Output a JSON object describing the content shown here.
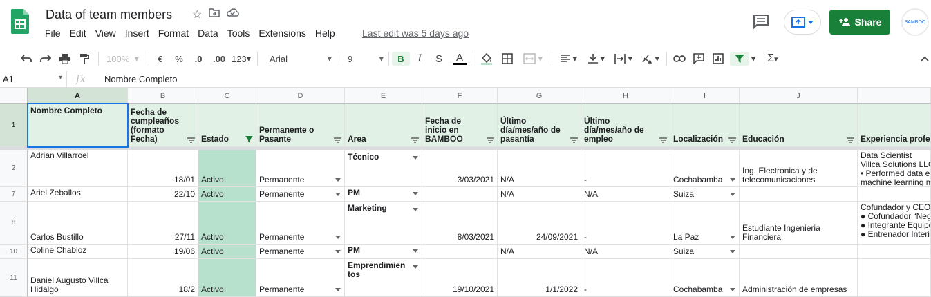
{
  "app": {
    "doc_title": "Data of team members",
    "menu": [
      "File",
      "Edit",
      "View",
      "Insert",
      "Format",
      "Data",
      "Tools",
      "Extensions",
      "Help"
    ],
    "last_edit": "Last edit was 5 days ago",
    "share_label": "Share",
    "avatar_text": "BAMBOO",
    "brand_color": "#188038"
  },
  "toolbar": {
    "zoom": "100%",
    "currency": "€",
    "percent": "%",
    "dec_less": ".0",
    "dec_more": ".00",
    "more_formats": "123",
    "font": "Arial",
    "font_size": "9",
    "bold": "B",
    "italic": "I",
    "strike": "S",
    "text_color": "A",
    "sigma": "Σ"
  },
  "formula_bar": {
    "cell_ref": "A1",
    "fx": "fx",
    "value": "Nombre Completo"
  },
  "columns": [
    "A",
    "B",
    "C",
    "D",
    "E",
    "F",
    "G",
    "H",
    "I",
    "J"
  ],
  "headers": {
    "a": "Nombre Completo",
    "b": "Fecha de cumpleaños (formato Fecha)",
    "c": "Estado",
    "d": "Permanente o Pasante",
    "e": "Area",
    "f": "Fecha de inicio en BAMBOO",
    "g": "Último día/mes/año de pasantía",
    "h": "Último día/mes/año de empleo",
    "i": "Localización",
    "j": "Educación",
    "k": "Experiencia profe"
  },
  "row_numbers": [
    "1",
    "2",
    "7",
    "8",
    "10",
    "11"
  ],
  "rows": [
    {
      "a": "Adrian Villarroel",
      "b": "18/01",
      "c": "Activo",
      "d": "Permanente",
      "e": "Técnico",
      "f": "3/03/2021",
      "g": "N/A",
      "h": "-",
      "i": "Cochabamba",
      "j": "Ing. Electronica y de telecomunicaciones",
      "k": "Data Scientist\nVillca Solutions LLC\n• Performed data e\nmachine learning m"
    },
    {
      "a": "Ariel Zeballos",
      "b": "22/10",
      "c": "Activo",
      "d": "Permanente",
      "e": "PM",
      "f": "",
      "g": "N/A",
      "h": "N/A",
      "i": "Suiza",
      "j": "",
      "k": ""
    },
    {
      "a": "Carlos Bustillo",
      "b": "27/11",
      "c": "Activo",
      "d": "Permanente",
      "e": "Marketing",
      "f": "8/03/2021",
      "g": "24/09/2021",
      "h": "-",
      "i": "La Paz",
      "j": "Estudiante Ingenieria Financiera",
      "k": "Cofundador y CEO\n● Cofundador “Neg\n● Integrante Equipo\n● Entrenador Interin"
    },
    {
      "a": "Coline Chabloz",
      "b": "19/06",
      "c": "Activo",
      "d": "Permanente",
      "e": "PM",
      "f": "",
      "g": "N/A",
      "h": "N/A",
      "i": "Suiza",
      "j": "",
      "k": ""
    },
    {
      "a": "Daniel Augusto Villca Hidalgo",
      "b": "18/2",
      "c": "Activo",
      "d": "Permanente",
      "e": "Emprendimientos",
      "f": "19/10/2021",
      "g": "1/1/2022",
      "h": "-",
      "i": "Cochabamba",
      "j": "Administración de empresas",
      "k": ""
    }
  ]
}
